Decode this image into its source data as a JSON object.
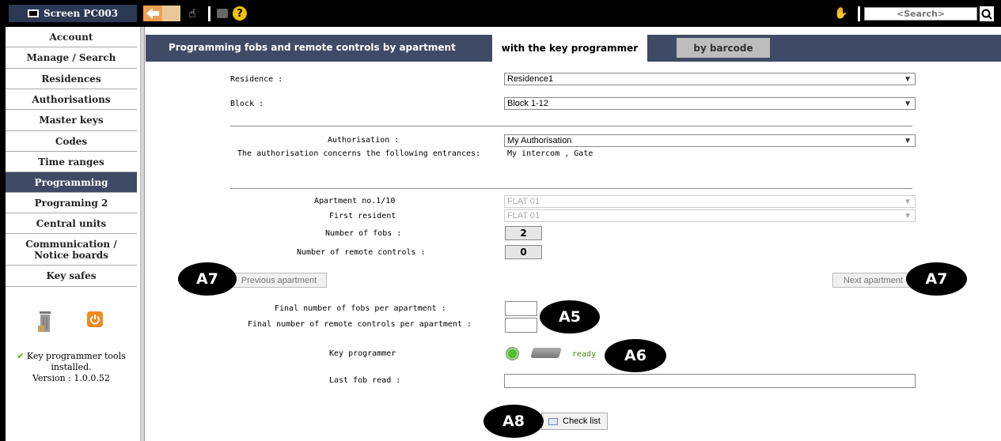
{
  "topbar": {
    "screen_title": "Screen PC003",
    "search_placeholder": "<Search>",
    "icons": [
      "back-arrow-icon",
      "forward-icon",
      "pointer-icon",
      "print-icon",
      "help-icon",
      "ear-icon",
      "search-icon"
    ]
  },
  "sidebar": {
    "items": [
      {
        "label": "Account"
      },
      {
        "label": "Manage / Search"
      },
      {
        "label": "Residences"
      },
      {
        "label": "Authorisations"
      },
      {
        "label": "Master keys"
      },
      {
        "label": "Codes"
      },
      {
        "label": "Time ranges"
      },
      {
        "label": "Programming",
        "active": true
      },
      {
        "label": "Programing 2"
      },
      {
        "label": "Central units"
      },
      {
        "label": "Communication / Notice boards"
      },
      {
        "label": "Key safes"
      }
    ],
    "tools_status": "Key programmer tools installed.",
    "tools_version": "Version : 1.0.0.52"
  },
  "header": {
    "title": "Programming fobs and remote controls by apartment",
    "tabs": [
      {
        "label": "with the key programmer",
        "active": true
      },
      {
        "label": "by barcode",
        "active": false
      }
    ]
  },
  "form": {
    "residence_label": "Residence :",
    "residence_value": "Residence1",
    "block_label": "Block :",
    "block_value": "Block 1-12",
    "authorisation_label": "Authorisation :",
    "authorisation_value": "My Authorisation",
    "entrances_label": "The authorisation concerns the following entrances:",
    "entrances_value": "My intercom , Gate",
    "apartment_label": "Apartment no.1/10",
    "apartment_value": "FLAT 01",
    "first_resident_label": "First resident",
    "first_resident_value": "FLAT 01",
    "fobs_label": "Number of fobs :",
    "fobs_value": "2",
    "remotes_label": "Number of remote controls :",
    "remotes_value": "0",
    "prev_button": "Previous apartment",
    "next_button": "Next apartment",
    "final_fobs_label": "Final number of fobs per apartment :",
    "final_remotes_label": "Final number of remote controls per apartment :",
    "final_fobs_value": "",
    "final_remotes_value": "",
    "key_programmer_label": "Key programmer",
    "key_programmer_status": "ready",
    "last_fob_label": "Last fob read :",
    "last_fob_value": "",
    "check_list_button": "Check list"
  },
  "callouts": {
    "a7_left": "A7",
    "a7_right": "A7",
    "a5": "A5",
    "a6": "A6",
    "a8": "A8"
  },
  "colors": {
    "header_bg": "#3f4b66",
    "active_sidebar_bg": "#3f4b66",
    "search_text": "#ff8a00",
    "status_ready": "#3b8a18",
    "led": "#4fbf2a"
  }
}
